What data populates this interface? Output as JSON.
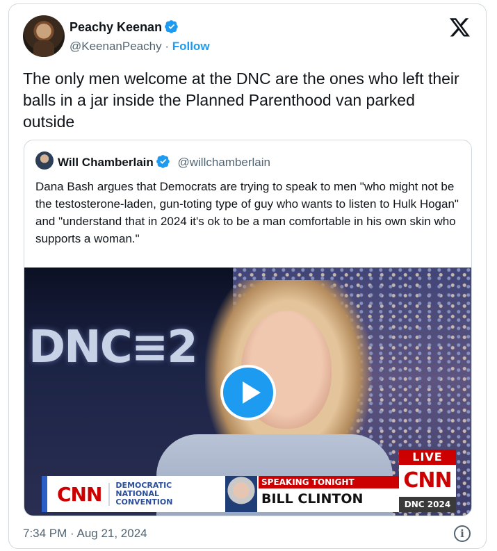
{
  "author": {
    "name": "Peachy Keenan",
    "handle": "@KeenanPeachy",
    "separator": "·",
    "follow_label": "Follow",
    "verified_icon": "verified-badge-icon"
  },
  "platform_logo": "X",
  "tweet_text": "The only men welcome at the DNC are the ones who left their balls in a jar inside the Planned Parenthood van parked outside",
  "quote": {
    "name": "Will Chamberlain",
    "handle": "@willchamberlain",
    "text": "Dana Bash argues that Democrats are trying to speak to men \"who might not be the testosterone-laden, gun-toting type of guy who wants to listen to Hulk Hogan\" and \"understand that in 2024 it's ok to be a man comfortable in his own skin who supports a woman.\"",
    "video": {
      "sign_text": "DNC≡2",
      "chyron_network": "CNN",
      "chyron_event": [
        "DEMOCRATIC",
        "NATIONAL",
        "CONVENTION"
      ],
      "speaking_label": "SPEAKING TONIGHT",
      "speaker": "BILL CLINTON",
      "live_label": "LIVE",
      "live_network": "CNN",
      "event_tag": "DNC 2024"
    }
  },
  "timestamp": "7:34 PM · Aug 21, 2024",
  "info_icon": "i",
  "colors": {
    "accent": "#1d9bf0",
    "text": "#0f1419",
    "muted": "#536471",
    "cnn_red": "#cc0000"
  }
}
